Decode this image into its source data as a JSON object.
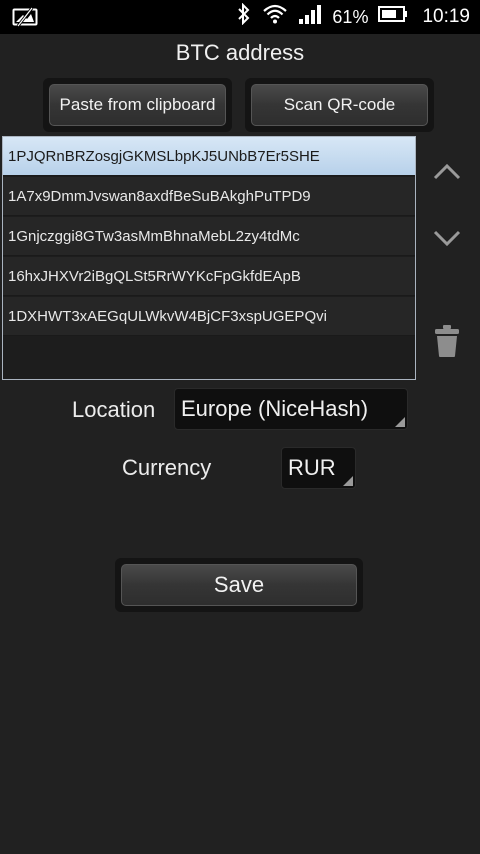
{
  "status_bar": {
    "battery_percent": "61%",
    "time": "10:19",
    "icons": [
      "photo-icon",
      "bluetooth-icon",
      "wifi-icon",
      "signal-icon",
      "battery-icon"
    ]
  },
  "title": "BTC address",
  "actions": {
    "paste_label": "Paste from clipboard",
    "scan_label": "Scan QR-code"
  },
  "addresses": [
    "1PJQRnBRZosgjGKMSLbpKJ5UNbB7Er5SHE",
    "1A7x9DmmJvswan8axdfBeSuBAkghPuTPD9",
    "1Gnjczggi8GTw3asMmBhnaMebL2zy4tdMc",
    "16hxJHXVr2iBgQLSt5RrWYKcFpGkfdEApB",
    "1DXHWT3xAEGqULWkvW4BjCF3xspUGEPQvi"
  ],
  "selected_index": 0,
  "location": {
    "label": "Location",
    "value": "Europe (NiceHash)"
  },
  "currency": {
    "label": "Currency",
    "value": "RUR"
  },
  "save_label": "Save",
  "colors": {
    "background": "#212121",
    "selected_row": "#c8dcf0",
    "status_bar": "#000000"
  }
}
